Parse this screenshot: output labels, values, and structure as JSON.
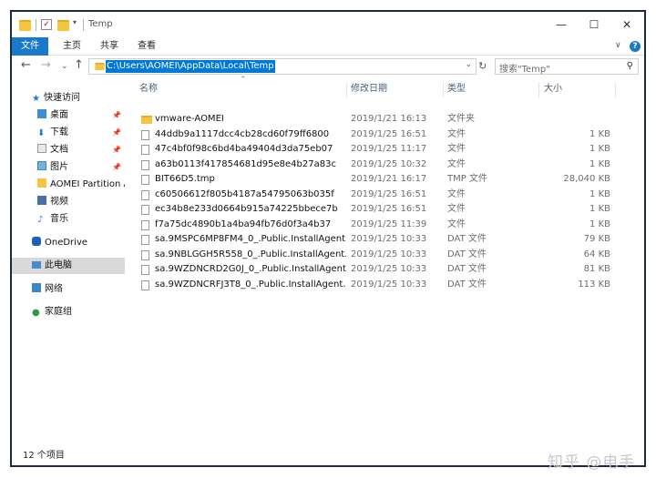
{
  "window": {
    "title": "Temp",
    "controls": {
      "minimize": "—",
      "maximize": "☐",
      "close": "✕"
    }
  },
  "ribbon": {
    "tabs": [
      "文件",
      "主页",
      "共享",
      "查看"
    ]
  },
  "address": {
    "path": "C:\\Users\\AOMEI\\AppData\\Local\\Temp",
    "search_placeholder": "搜索\"Temp\""
  },
  "nav": {
    "quick_access": "快速访问",
    "items": [
      {
        "label": "桌面",
        "pinned": true
      },
      {
        "label": "下载",
        "pinned": true
      },
      {
        "label": "文档",
        "pinned": true
      },
      {
        "label": "图片",
        "pinned": true
      },
      {
        "label": "AOMEI Partition A",
        "pinned": false
      },
      {
        "label": "视频",
        "pinned": false
      },
      {
        "label": "音乐",
        "pinned": false
      }
    ],
    "onedrive": "OneDrive",
    "this_pc": "此电脑",
    "network": "网络",
    "homegroup": "家庭组"
  },
  "columns": {
    "name": "名称",
    "modified": "修改日期",
    "type": "类型",
    "size": "大小"
  },
  "files": [
    {
      "name": "vmware-AOMEI",
      "modified": "2019/1/21 16:13",
      "type": "文件夹",
      "size": "",
      "kind": "folder"
    },
    {
      "name": "44ddb9a1117dcc4cb28cd60f79ff6800",
      "modified": "2019/1/25 16:51",
      "type": "文件",
      "size": "1 KB",
      "kind": "file"
    },
    {
      "name": "47c4bf0f98c6bd4ba49404d3da75eb07",
      "modified": "2019/1/25 11:17",
      "type": "文件",
      "size": "1 KB",
      "kind": "file"
    },
    {
      "name": "a63b0113f417854681d95e8e4b27a83c",
      "modified": "2019/1/25 10:32",
      "type": "文件",
      "size": "1 KB",
      "kind": "file"
    },
    {
      "name": "BIT66D5.tmp",
      "modified": "2019/1/21 16:17",
      "type": "TMP 文件",
      "size": "28,040 KB",
      "kind": "file"
    },
    {
      "name": "c60506612f805b4187a54795063b035f",
      "modified": "2019/1/25 16:51",
      "type": "文件",
      "size": "1 KB",
      "kind": "file"
    },
    {
      "name": "ec34b8e233d0664b915a74225bbece7b",
      "modified": "2019/1/25 16:51",
      "type": "文件",
      "size": "1 KB",
      "kind": "file"
    },
    {
      "name": "f7a75dc4890b1a4ba94fb76d0f3a4b37",
      "modified": "2019/1/25 11:39",
      "type": "文件",
      "size": "1 KB",
      "kind": "file"
    },
    {
      "name": "sa.9MSPC6MP8FM4_0_.Public.InstallAgent....",
      "modified": "2019/1/25 10:33",
      "type": "DAT 文件",
      "size": "79 KB",
      "kind": "file"
    },
    {
      "name": "sa.9NBLGGH5R558_0_.Public.InstallAgent....",
      "modified": "2019/1/25 10:33",
      "type": "DAT 文件",
      "size": "64 KB",
      "kind": "file"
    },
    {
      "name": "sa.9WZDNCRD2G0J_0_.Public.InstallAgent....",
      "modified": "2019/1/25 10:33",
      "type": "DAT 文件",
      "size": "81 KB",
      "kind": "file"
    },
    {
      "name": "sa.9WZDNCRFJ3T8_0_.Public.InstallAgent....",
      "modified": "2019/1/25 10:33",
      "type": "DAT 文件",
      "size": "113 KB",
      "kind": "file"
    }
  ],
  "status": {
    "item_count": "12 个项目"
  },
  "watermark": "知乎 @电手",
  "colors": {
    "accent": "#1979ca",
    "selection": "#0078d7",
    "folder": "#f5c542"
  }
}
